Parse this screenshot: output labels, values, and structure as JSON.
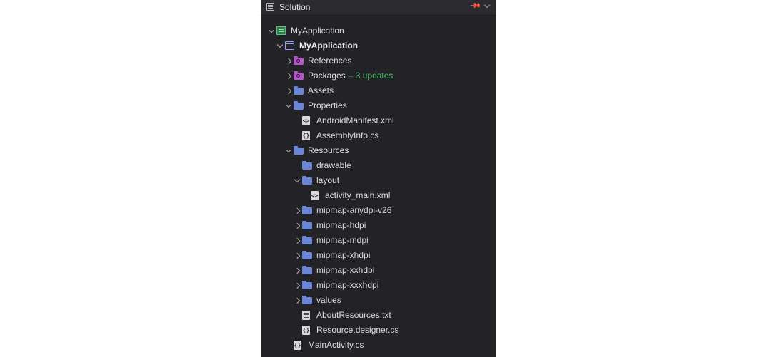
{
  "header": {
    "title": "Solution",
    "pin_icon": "pin-icon",
    "menu_icon": "chevron-down-icon"
  },
  "tree": [
    {
      "label": "MyApplication",
      "level": 0,
      "icon": "solution",
      "chevron": "open",
      "bold": false
    },
    {
      "label": "MyApplication",
      "level": 1,
      "icon": "project",
      "chevron": "open",
      "bold": true
    },
    {
      "label": "References",
      "level": 2,
      "icon": "pfolder",
      "chevron": "closed"
    },
    {
      "label": "Packages",
      "level": 2,
      "icon": "pfolder",
      "chevron": "closed",
      "badge": "– 3 updates"
    },
    {
      "label": "Assets",
      "level": 2,
      "icon": "folder",
      "chevron": "closed"
    },
    {
      "label": "Properties",
      "level": 2,
      "icon": "folder",
      "chevron": "open"
    },
    {
      "label": "AndroidManifest.xml",
      "level": 3,
      "icon": "xml",
      "chevron": "none"
    },
    {
      "label": "AssemblyInfo.cs",
      "level": 3,
      "icon": "cs",
      "chevron": "none"
    },
    {
      "label": "Resources",
      "level": 2,
      "icon": "folder",
      "chevron": "open"
    },
    {
      "label": "drawable",
      "level": 3,
      "icon": "folder",
      "chevron": "none"
    },
    {
      "label": "layout",
      "level": 3,
      "icon": "folder",
      "chevron": "open"
    },
    {
      "label": "activity_main.xml",
      "level": 4,
      "icon": "xml",
      "chevron": "none"
    },
    {
      "label": "mipmap-anydpi-v26",
      "level": 3,
      "icon": "folder",
      "chevron": "closed"
    },
    {
      "label": "mipmap-hdpi",
      "level": 3,
      "icon": "folder",
      "chevron": "closed"
    },
    {
      "label": "mipmap-mdpi",
      "level": 3,
      "icon": "folder",
      "chevron": "closed"
    },
    {
      "label": "mipmap-xhdpi",
      "level": 3,
      "icon": "folder",
      "chevron": "closed"
    },
    {
      "label": "mipmap-xxhdpi",
      "level": 3,
      "icon": "folder",
      "chevron": "closed"
    },
    {
      "label": "mipmap-xxxhdpi",
      "level": 3,
      "icon": "folder",
      "chevron": "closed"
    },
    {
      "label": "values",
      "level": 3,
      "icon": "folder",
      "chevron": "closed"
    },
    {
      "label": "AboutResources.txt",
      "level": 3,
      "icon": "txt",
      "chevron": "none"
    },
    {
      "label": "Resource.designer.cs",
      "level": 3,
      "icon": "cs",
      "chevron": "none"
    },
    {
      "label": "MainActivity.cs",
      "level": 2,
      "icon": "cs",
      "chevron": "none"
    }
  ],
  "colors": {
    "panel_bg": "#232327",
    "badge": "#4fb86a",
    "folder": "#6b86d6",
    "package_folder": "#b358c8"
  }
}
